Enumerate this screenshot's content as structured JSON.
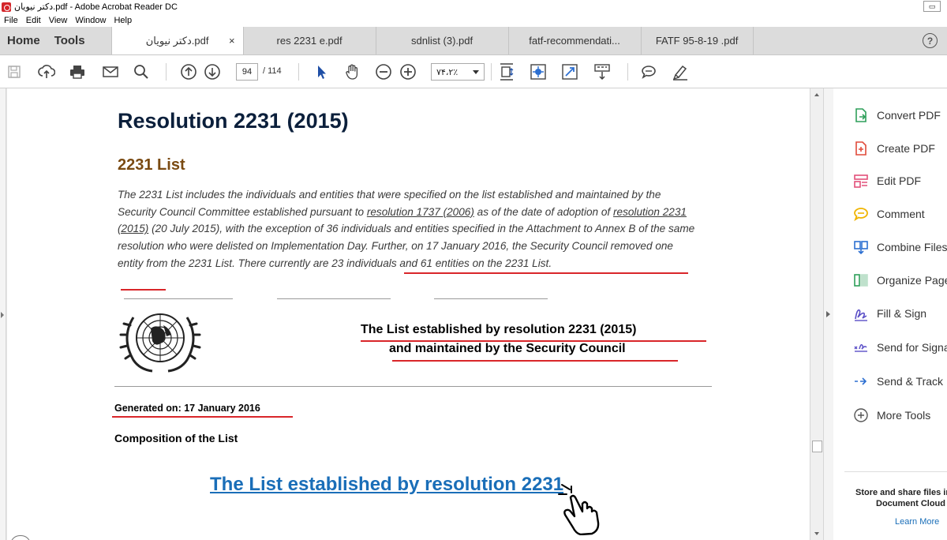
{
  "window": {
    "title": "دکتر نیویان.pdf - Adobe Acrobat Reader DC"
  },
  "menu": [
    "File",
    "Edit",
    "View",
    "Window",
    "Help"
  ],
  "nav_tabs": [
    "Home",
    "Tools"
  ],
  "doc_tabs": [
    {
      "label": "دکتر نیویان.pdf",
      "active": true,
      "close": "×"
    },
    {
      "label": "res 2231 e.pdf",
      "active": false
    },
    {
      "label": "sdnlist (3).pdf",
      "active": false
    },
    {
      "label": "fatf-recommendati...",
      "active": false
    },
    {
      "label": "FATF  95-8-19  .pdf",
      "active": false
    }
  ],
  "help_label": "?",
  "toolbar": {
    "current_page": "94",
    "total_pages": "/ 114",
    "zoom": "۷۴،۲٪",
    "icons": [
      "save-icon",
      "upload-icon",
      "print-icon",
      "email-icon",
      "search-icon",
      "prev-page-icon",
      "next-page-icon",
      "select-arrow-icon",
      "hand-icon",
      "zoom-out-icon",
      "zoom-in-icon",
      "fit-page-icon",
      "marquee-zoom-icon",
      "full-screen-icon",
      "scroll-mode-icon",
      "comment-icon",
      "highlight-icon"
    ]
  },
  "document": {
    "title": "Resolution 2231 (2015)",
    "subtitle": "2231 List",
    "paragraph": {
      "p1": "The 2231 List includes the individuals and entities that were specified on the list established and maintained by the Security Council Committee established pursuant to ",
      "link1": "resolution 1737 (2006)",
      "p2": " as of the date of adoption of ",
      "link2": "resolution 2231 (2015)",
      "p3": " (20 July 2015), with the exception of 36 individuals and entities specified in the Attachment to Annex B of the same resolution who were delisted on Implementation Day. Further, on 17 January 2016, the Security Council removed one entity from the 2231 List. There currently are 23 individuals and 61 entities on the 2231 List."
    },
    "list_heading_line1": "The List established by resolution 2231 (2015)",
    "list_heading_line2": "and maintained by the Security Council",
    "generated": "Generated on: 17 January 2016",
    "composition": "Composition of the List",
    "big_link": "The List established by resolution 2231"
  },
  "right_panel": {
    "tools": [
      {
        "label": "Convert PDF",
        "icon": "convert-pdf-icon",
        "color": "#2e9f5a"
      },
      {
        "label": "Create PDF",
        "icon": "create-pdf-icon",
        "color": "#e04a3a"
      },
      {
        "label": "Edit PDF",
        "icon": "edit-pdf-icon",
        "color": "#e2507a"
      },
      {
        "label": "Comment",
        "icon": "comment-icon",
        "color": "#f0b400"
      },
      {
        "label": "Combine Files",
        "icon": "combine-files-icon",
        "color": "#2c6fd1"
      },
      {
        "label": "Organize Pages",
        "icon": "organize-pages-icon",
        "color": "#2e9f5a"
      },
      {
        "label": "Fill & Sign",
        "icon": "fill-sign-icon",
        "color": "#5b4fc7"
      },
      {
        "label": "Send for Signature",
        "icon": "send-signature-icon",
        "color": "#5b4fc7"
      },
      {
        "label": "Send & Track",
        "icon": "send-track-icon",
        "color": "#2c6fd1"
      },
      {
        "label": "More Tools",
        "icon": "more-tools-icon",
        "color": "#555555"
      }
    ],
    "store_line1": "Store and share files in the",
    "store_line2": "Document Cloud",
    "learn_more": "Learn More"
  },
  "colors": {
    "accent_red": "#d9262a",
    "link_blue": "#1a6eb8",
    "title_navy": "#0b1f3b",
    "subtitle_brown": "#7a4a12"
  }
}
